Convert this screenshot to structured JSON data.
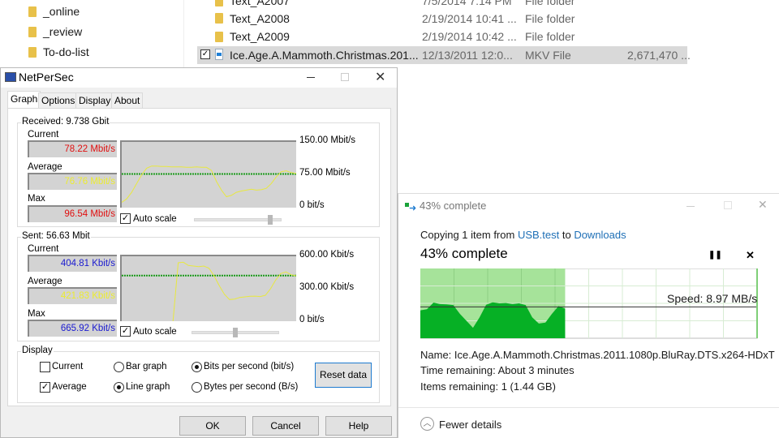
{
  "explorer": {
    "nav_items": [
      {
        "label": "_online"
      },
      {
        "label": "_review"
      },
      {
        "label": "To-do-list"
      }
    ],
    "files": [
      {
        "name": "Text_A2007",
        "date": "7/5/2014 7:14 PM",
        "type": "File folder",
        "size": "",
        "icon": "folder-icon"
      },
      {
        "name": "Text_A2008",
        "date": "2/19/2014 10:41 ...",
        "type": "File folder",
        "size": "",
        "icon": "folder-icon"
      },
      {
        "name": "Text_A2009",
        "date": "2/19/2014 10:42 ...",
        "type": "File folder",
        "size": "",
        "icon": "folder-icon"
      },
      {
        "name": "Ice.Age.A.Mammoth.Christmas.201...",
        "date": "12/13/2011 12:0...",
        "type": "MKV File",
        "size": "2,671,470 ...",
        "icon": "video-file-icon",
        "selected": true,
        "checked": true
      }
    ]
  },
  "netpersec": {
    "title": "NetPerSec",
    "tabs": [
      {
        "label": "Graph",
        "active": true
      },
      {
        "label": "Options"
      },
      {
        "label": "Display"
      },
      {
        "label": "About"
      }
    ],
    "received": {
      "title": "Received: 9.738 Gbit",
      "current_label": "Current",
      "current": "78.22 Mbit/s",
      "average_label": "Average",
      "average": "76.76 Mbit/s",
      "max_label": "Max",
      "max": "96.54 Mbit/s",
      "scale_top": "150.00 Mbit/s",
      "scale_mid": "75.00 Mbit/s",
      "scale_bottom": "0 bit/s",
      "auto_scale": "Auto scale",
      "auto_scale_checked": true,
      "slider_level": 0.9,
      "chart_data": {
        "type": "line",
        "ylim": [
          0,
          150
        ],
        "unit": "Mbit/s",
        "average": 76.76,
        "values": [
          12,
          20,
          35,
          55,
          75,
          90,
          95,
          95,
          94,
          94,
          93,
          93,
          93,
          92,
          92,
          93,
          92,
          92,
          85,
          60,
          40,
          25,
          28,
          35,
          38,
          40,
          42,
          40,
          41,
          44,
          55,
          70,
          82,
          84,
          80,
          78
        ]
      }
    },
    "sent": {
      "title": "Sent: 56.63 Mbit",
      "current_label": "Current",
      "current": "404.81 Kbit/s",
      "average_label": "Average",
      "average": "421.83 Kbit/s",
      "max_label": "Max",
      "max": "665.92 Kbit/s",
      "scale_top": "600.00 Kbit/s",
      "scale_mid": "300.00 Kbit/s",
      "scale_bottom": "0 bit/s",
      "auto_scale": "Auto scale",
      "auto_scale_checked": true,
      "slider_level": 0.5,
      "chart_data": {
        "type": "line",
        "ylim": [
          0,
          600
        ],
        "unit": "Kbit/s",
        "average": 421.83,
        "values": [
          null,
          null,
          null,
          null,
          null,
          null,
          null,
          null,
          null,
          null,
          0,
          540,
          545,
          515,
          510,
          505,
          510,
          490,
          420,
          330,
          250,
          200,
          205,
          220,
          225,
          230,
          232,
          228,
          240,
          300,
          380,
          440,
          455,
          430,
          420
        ]
      }
    },
    "display": {
      "title": "Display",
      "current": {
        "label": "Current",
        "checked": false
      },
      "average": {
        "label": "Average",
        "checked": true
      },
      "bar_graph": {
        "label": "Bar graph",
        "selected": false
      },
      "line_graph": {
        "label": "Line graph",
        "selected": true
      },
      "bits": {
        "label": "Bits per second (bit/s)",
        "selected": true
      },
      "bytes": {
        "label": "Bytes per second (B/s)",
        "selected": false
      },
      "reset": "Reset data"
    },
    "ok": "OK",
    "cancel": "Cancel",
    "help": "Help"
  },
  "copy": {
    "title": "43% complete",
    "copying_prefix": "Copying 1 item from ",
    "source": "USB.test",
    "to": " to ",
    "dest": "Downloads",
    "heading": "43% complete",
    "progress": 0.43,
    "speed": "Speed: 8.97 MB/s",
    "chart_data": {
      "type": "area",
      "unit": "MB/s",
      "ylim": [
        0,
        20
      ],
      "current_speed": 8.97,
      "values": [
        8,
        8.3,
        10.2,
        9.8,
        9.7,
        9.5,
        7,
        5,
        3,
        6,
        9.6,
        10.3,
        10,
        10.1,
        9.8,
        10,
        9.5,
        6,
        4.2,
        4.5,
        7,
        9.2,
        8.5
      ]
    },
    "name_label": "Name:",
    "name": "Ice.Age.A.Mammoth.Christmas.2011.1080p.BluRay.DTS.x264-HDxT",
    "time_label": "Time remaining:",
    "time": "About 3 minutes",
    "items_label": "Items remaining:",
    "items": "1 (1.44 GB)",
    "fewer": "Fewer details"
  }
}
